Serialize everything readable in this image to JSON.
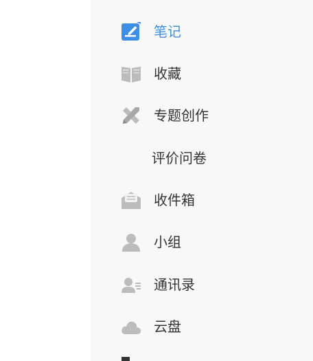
{
  "sidebar": {
    "items": [
      {
        "label": "笔记",
        "icon": "edit-note-icon",
        "active": true
      },
      {
        "label": "收藏",
        "icon": "book-icon"
      },
      {
        "label": "专题创作",
        "icon": "pencil-ruler-icon"
      },
      {
        "label": "评价问卷",
        "icon": ""
      },
      {
        "label": "收件箱",
        "icon": "mail-icon"
      },
      {
        "label": "小组",
        "icon": "user-icon"
      },
      {
        "label": "通讯录",
        "icon": "contacts-icon"
      },
      {
        "label": "云盘",
        "icon": "cloud-icon"
      }
    ]
  },
  "colors": {
    "accent": "#3d8fe6",
    "icon_gray": "#bcbcbc",
    "text": "#333333",
    "sidebar_bg": "#f8f8f8"
  }
}
